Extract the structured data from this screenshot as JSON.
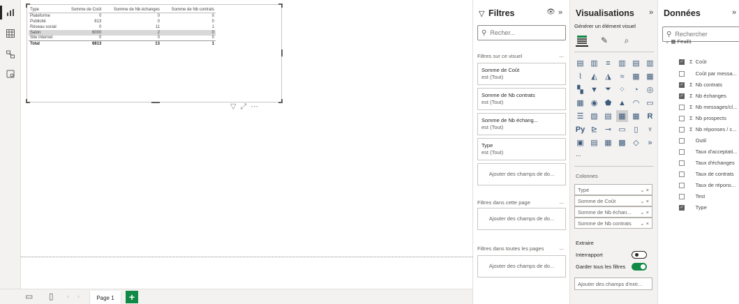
{
  "canvas": {
    "matrix": {
      "headers": [
        "Type",
        "Somme de Coût",
        "Somme de Nb échanges",
        "Somme de Nb contrats"
      ],
      "rows": [
        [
          "Plateforme",
          "0",
          "0",
          "0"
        ],
        [
          "Publicité",
          "813",
          "0",
          "0"
        ],
        [
          "Réseau social",
          "0",
          "11",
          "1"
        ],
        [
          "Salon",
          "6000",
          "2",
          "0"
        ],
        [
          "Site Internet",
          "0",
          "0",
          "0"
        ]
      ],
      "total": [
        "Total",
        "6813",
        "13",
        "1"
      ]
    }
  },
  "bottombar": {
    "page_tab": "Page 1",
    "add_page": "+"
  },
  "filters": {
    "title": "Filtres",
    "search_placeholder": "Recher...",
    "on_visual_label": "Filtres sur ce visuel",
    "more": "...",
    "cards": [
      {
        "title": "Somme de Coût",
        "state": "est (Tout)"
      },
      {
        "title": "Somme de Nb contrats",
        "state": "est (Tout)"
      },
      {
        "title": "Somme de Nb échang...",
        "state": "est (Tout)"
      },
      {
        "title": "Type",
        "state": "est (Tout)"
      }
    ],
    "add_fields": "Ajouter des champs de do...",
    "on_page_label": "Filtres dans cette page",
    "on_all_pages_label": "Filtres dans toutes les pages"
  },
  "visualizations": {
    "title": "Visualisations",
    "subtitle": "Générer un élément visuel",
    "more_dots": "...",
    "columns_label": "Colonnes",
    "wells": [
      "Type",
      "Somme de Coût",
      "Somme de Nb échan...",
      "Somme de Nb contrats"
    ],
    "drill_label": "Extraire",
    "cross_report": "Interrapport",
    "keep_filters": "Garder tous les filtres",
    "add_drill": "Ajouter des champs d'extr..."
  },
  "data": {
    "title": "Données",
    "search_placeholder": "Rechercher",
    "table_name": "Feuil1",
    "fields": [
      {
        "name": "Coût",
        "sigma": true,
        "checked": true
      },
      {
        "name": "Coût par messa...",
        "sigma": false,
        "checked": false
      },
      {
        "name": "Nb contrats",
        "sigma": true,
        "checked": true
      },
      {
        "name": "Nb échanges",
        "sigma": true,
        "checked": true
      },
      {
        "name": "Nb messages/cl...",
        "sigma": true,
        "checked": false
      },
      {
        "name": "Nb prospects",
        "sigma": true,
        "checked": false
      },
      {
        "name": "Nb réponses / c...",
        "sigma": true,
        "checked": false
      },
      {
        "name": "Outil",
        "sigma": false,
        "checked": false
      },
      {
        "name": "Taux d'acceptati...",
        "sigma": false,
        "checked": false
      },
      {
        "name": "Taux d'échanges",
        "sigma": false,
        "checked": false
      },
      {
        "name": "Taux de contrats",
        "sigma": false,
        "checked": false
      },
      {
        "name": "Taux de répons...",
        "sigma": false,
        "checked": false
      },
      {
        "name": "Test",
        "sigma": false,
        "checked": false
      },
      {
        "name": "Type",
        "sigma": false,
        "checked": true
      }
    ]
  }
}
